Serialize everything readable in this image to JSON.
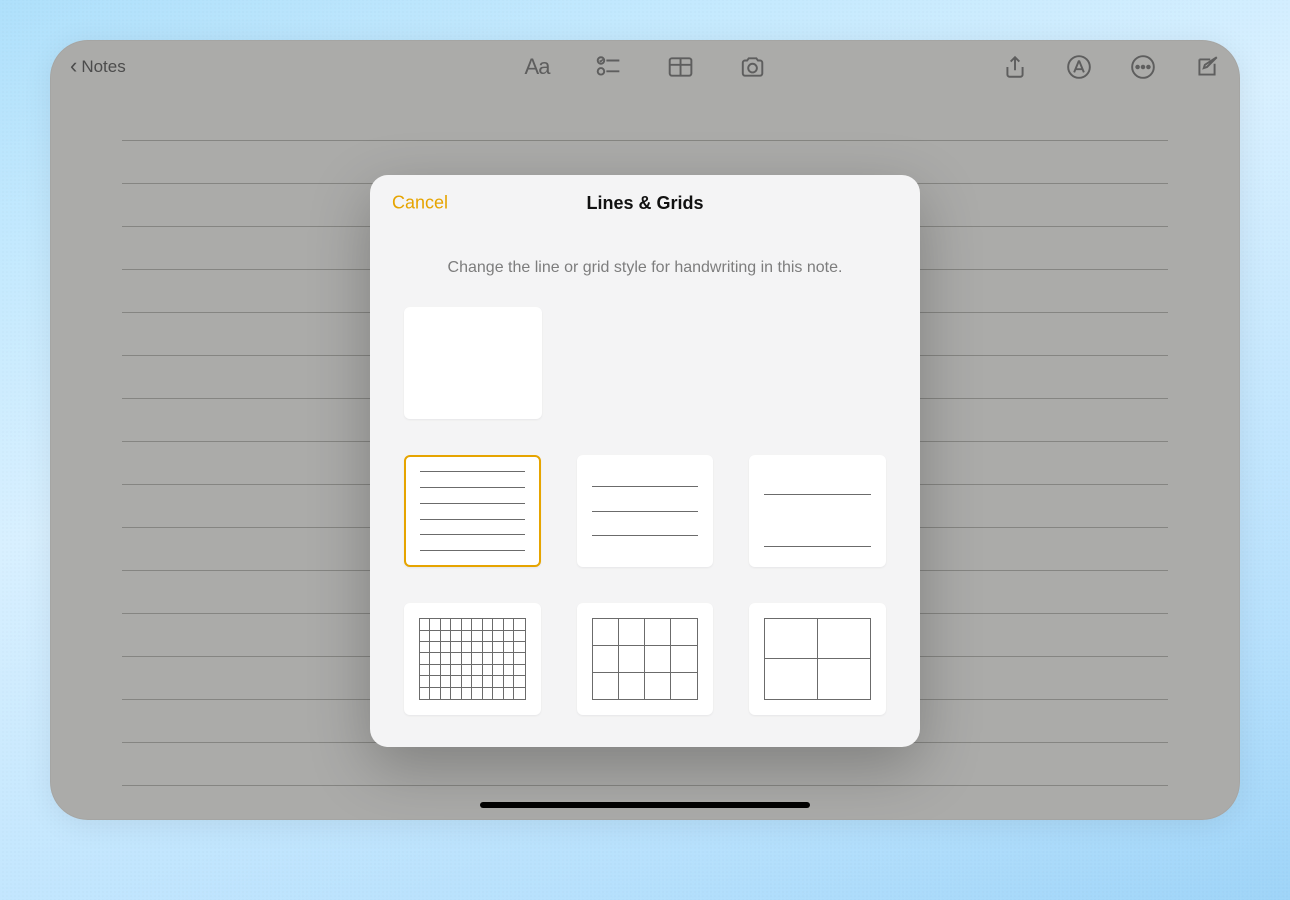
{
  "toolbar": {
    "back_label": "Notes"
  },
  "modal": {
    "cancel_label": "Cancel",
    "title": "Lines & Grids",
    "subtitle": "Change the line or grid style for handwriting in this note.",
    "styles": [
      {
        "id": "blank",
        "selected": false
      },
      {
        "id": "lines-narrow",
        "selected": true
      },
      {
        "id": "lines-medium",
        "selected": false
      },
      {
        "id": "lines-wide",
        "selected": false
      },
      {
        "id": "grid-small",
        "selected": false
      },
      {
        "id": "grid-medium",
        "selected": false
      },
      {
        "id": "grid-large",
        "selected": false
      }
    ]
  },
  "colors": {
    "accent": "#e6a400"
  }
}
